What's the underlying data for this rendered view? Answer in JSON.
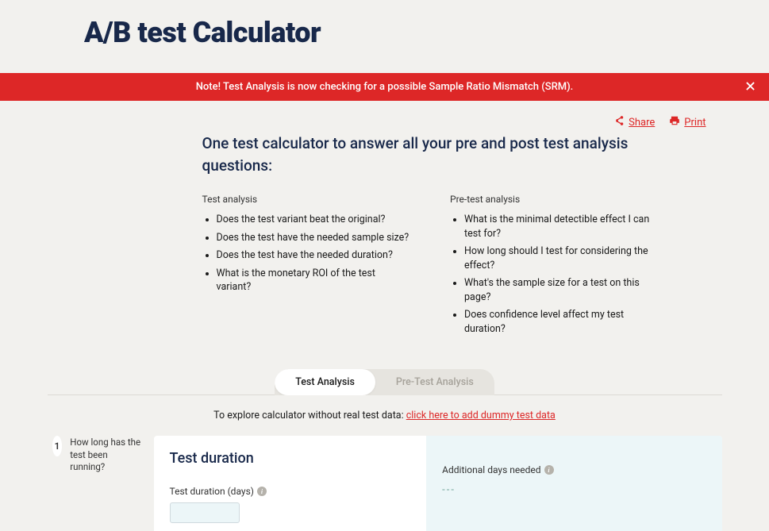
{
  "header": {
    "title": "A/B test Calculator"
  },
  "alert": {
    "text": "Note! Test Analysis is now checking for a possible Sample Ratio Mismatch (SRM)."
  },
  "actions": {
    "share": "Share",
    "print": "Print"
  },
  "intro": {
    "heading": "One test calculator to answer all your pre and post test analysis questions:",
    "colA": {
      "heading": "Test analysis",
      "items": [
        "Does the test variant beat the original?",
        "Does the test have the needed sample size?",
        "Does the test have the needed duration?",
        "What is the monetary ROI of the test variant?"
      ]
    },
    "colB": {
      "heading": "Pre-test analysis",
      "items": [
        "What is the minimal detectible effect I can test for?",
        "How long should I test for considering the effect?",
        "What's the sample size for a test on this page?",
        "Does confidence level affect my test duration?"
      ]
    }
  },
  "tabs": {
    "a": "Test Analysis",
    "b": "Pre-Test Analysis"
  },
  "dummy": {
    "lead": "To explore calculator without real test data: ",
    "link": "click here to add dummy test data"
  },
  "step1": {
    "num": "1",
    "label": "How long has the test been running?",
    "panel_title": "Test duration",
    "field_label": "Test duration (days)",
    "result_label": "Additional days needed",
    "result_value": "---"
  }
}
